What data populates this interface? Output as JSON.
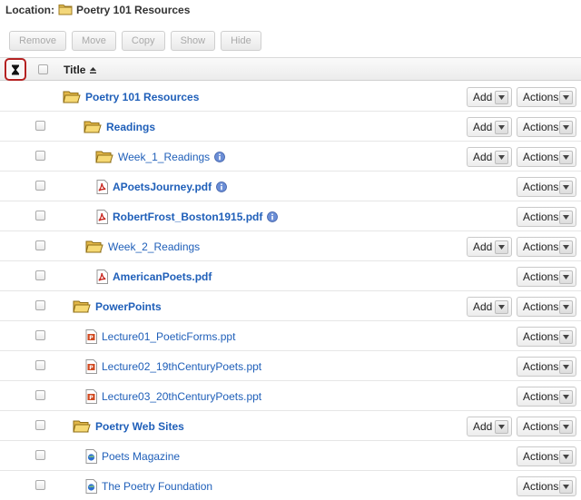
{
  "location": {
    "label": "Location:",
    "value": "Poetry 101 Resources"
  },
  "toolbar": {
    "buttons": [
      "Remove",
      "Move",
      "Copy",
      "Show",
      "Hide"
    ]
  },
  "header": {
    "title": "Title"
  },
  "add_label": "Add",
  "actions_label": "Actions",
  "rows": [
    {
      "name": "Poetry 101 Resources",
      "type": "folder-open",
      "bold": true,
      "checkbox": false,
      "add": true,
      "info": false
    },
    {
      "name": "Readings",
      "type": "folder-open",
      "bold": true,
      "checkbox": true,
      "add": true,
      "info": false
    },
    {
      "name": "Week_1_Readings",
      "type": "folder-open",
      "bold": false,
      "checkbox": true,
      "add": true,
      "info": true
    },
    {
      "name": "APoetsJourney.pdf",
      "type": "pdf",
      "bold": true,
      "checkbox": true,
      "add": false,
      "info": true
    },
    {
      "name": "RobertFrost_Boston1915.pdf",
      "type": "pdf",
      "bold": true,
      "checkbox": true,
      "add": false,
      "info": true
    },
    {
      "name": "Week_2_Readings",
      "type": "folder-open",
      "bold": false,
      "checkbox": true,
      "add": true,
      "info": false
    },
    {
      "name": "AmericanPoets.pdf",
      "type": "pdf",
      "bold": true,
      "checkbox": true,
      "add": false,
      "info": false
    },
    {
      "name": "PowerPoints",
      "type": "folder-open",
      "bold": true,
      "checkbox": true,
      "add": true,
      "info": false
    },
    {
      "name": "Lecture01_PoeticForms.ppt",
      "type": "ppt",
      "bold": false,
      "checkbox": true,
      "add": false,
      "info": false
    },
    {
      "name": "Lecture02_19thCenturyPoets.ppt",
      "type": "ppt",
      "bold": false,
      "checkbox": true,
      "add": false,
      "info": false
    },
    {
      "name": "Lecture03_20thCenturyPoets.ppt",
      "type": "ppt",
      "bold": false,
      "checkbox": true,
      "add": false,
      "info": false
    },
    {
      "name": "Poetry Web Sites",
      "type": "folder-open",
      "bold": true,
      "checkbox": true,
      "add": true,
      "info": false
    },
    {
      "name": "Poets Magazine",
      "type": "web",
      "bold": false,
      "checkbox": true,
      "add": false,
      "info": false
    },
    {
      "name": "The Poetry Foundation",
      "type": "web",
      "bold": false,
      "checkbox": true,
      "add": false,
      "info": false
    }
  ]
}
